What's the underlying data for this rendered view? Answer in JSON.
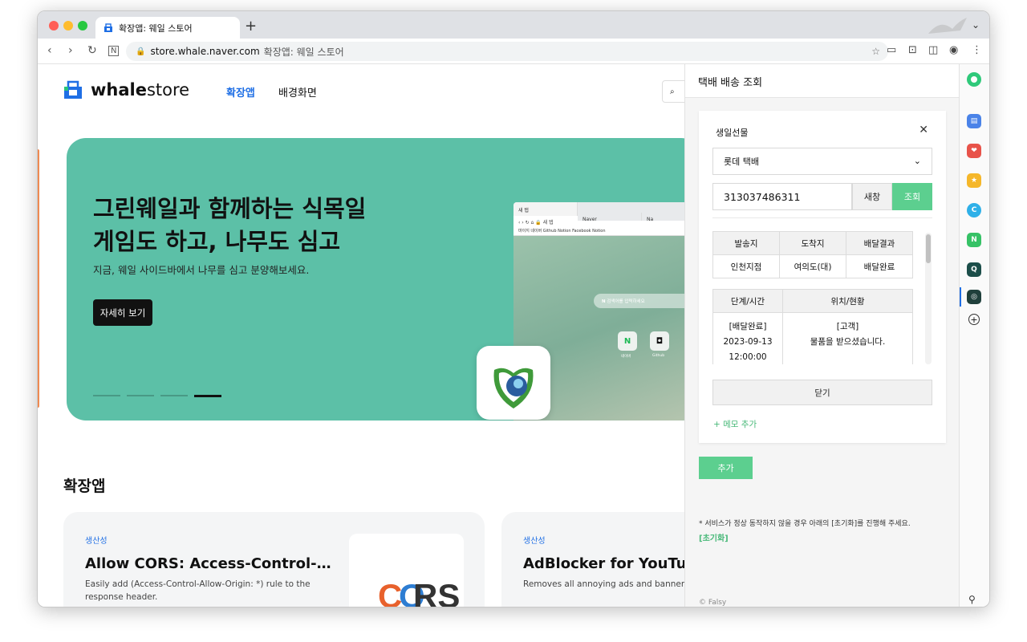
{
  "browser": {
    "tab_title": "확장앱: 웨일 스토어",
    "new_tab_label": "+",
    "url": "store.whale.naver.com",
    "url_title": "확장앱: 웨일 스토어"
  },
  "store": {
    "logo_bold": "whale",
    "logo_light": "store",
    "nav": [
      "확장앱",
      "배경화면"
    ],
    "search_glyph": "⌕"
  },
  "banner": {
    "title_line1": "그린웨일과 함께하는 식목일",
    "title_line2": "게임도 하고, 나무도 심고",
    "subtitle": "지금, 웨일 사이드바에서 나무를 심고 분양해보세요.",
    "button": "자세히 보기",
    "slide_count": 4,
    "active_slide": 4,
    "mock": {
      "tab1": "새 탭",
      "tab2": "Naver",
      "tab3": "Na",
      "url": "새 탭",
      "bookmarks": "마이지   네이버   Github   Notion   Facebook   Notion",
      "search_placeholder": "검색어를 입력하세요",
      "apps": [
        {
          "glyph": "N",
          "label": "네이버"
        },
        {
          "glyph": "◘",
          "label": "Github"
        }
      ]
    }
  },
  "section": {
    "title": "확장앱",
    "cards": [
      {
        "category": "생산성",
        "title": "Allow CORS: Access-Control-…",
        "description": "Easily add (Access-Control-Allow-Origin: *) rule to the response header.",
        "image_text": "CORS"
      },
      {
        "category": "생산성",
        "title": "AdBlocker for YouTube",
        "description": "Removes all annoying ads and banners fr"
      }
    ]
  },
  "panel": {
    "title": "택배 배송 조회",
    "item_label": "생일선물",
    "close_glyph": "✕",
    "carrier": "롯데 택배",
    "tracking_number": "313037486311",
    "new_window_button": "새창",
    "query_button": "조회",
    "summary_headers": [
      "발송지",
      "도착지",
      "배달결과"
    ],
    "summary_values": [
      "인천지점",
      "여의도(대)",
      "배달완료"
    ],
    "history_headers": [
      "단계/시간",
      "위치/현황"
    ],
    "history_rows": [
      {
        "stage": "[배달완료]",
        "date": "2023-09-13",
        "time": "12:00:00",
        "location": "[고객]",
        "status": "물품을 받으셨습니다."
      }
    ],
    "close_button": "닫기",
    "memo_link": "+ 메모 추가",
    "add_button": "추가",
    "notice": "* 서비스가 정상 동작하지 않을 경우 아래의 [초기화]를 진행해 주세요.",
    "reset_link": "[초기화]",
    "copyright": "© Falsy"
  },
  "colors": {
    "accent_green": "#5ccf8f",
    "link_blue": "#1f6fe5",
    "banner_bg": "#5cc0a7"
  }
}
